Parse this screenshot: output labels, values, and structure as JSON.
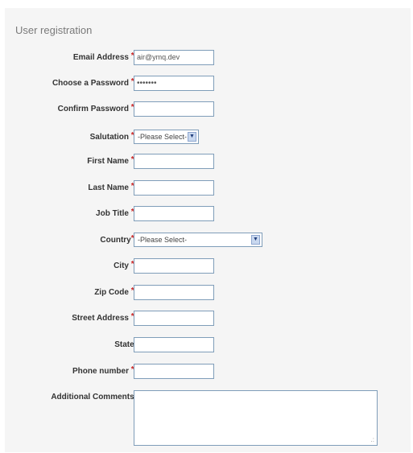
{
  "form": {
    "title": "User registration",
    "fields": {
      "email": {
        "label": "Email Address",
        "value": "air@ymq.dev"
      },
      "password": {
        "label": "Choose a Password",
        "value": "•••••••"
      },
      "confirm": {
        "label": "Confirm Password",
        "value": ""
      },
      "salutation": {
        "label": "Salutation",
        "value": "-Please Select-"
      },
      "first_name": {
        "label": "First Name",
        "value": ""
      },
      "last_name": {
        "label": "Last Name",
        "value": ""
      },
      "job_title": {
        "label": "Job Title",
        "value": ""
      },
      "country": {
        "label": "Country",
        "value": "-Please Select-"
      },
      "city": {
        "label": "City",
        "value": ""
      },
      "zip": {
        "label": "Zip Code",
        "value": ""
      },
      "street": {
        "label": "Street Address",
        "value": ""
      },
      "state": {
        "label": "State",
        "value": ""
      },
      "phone": {
        "label": "Phone number",
        "value": ""
      },
      "comments": {
        "label": "Additional Comments",
        "value": ""
      }
    },
    "required_mark": "*",
    "colon": ":"
  },
  "icons": {
    "dropdown_arrow": "chevron-down-icon",
    "resize_grip": "resize-grip-icon"
  },
  "colors": {
    "panel_bg": "#f5f5f5",
    "required": "#cc2222",
    "input_border": "#7f9db9"
  }
}
